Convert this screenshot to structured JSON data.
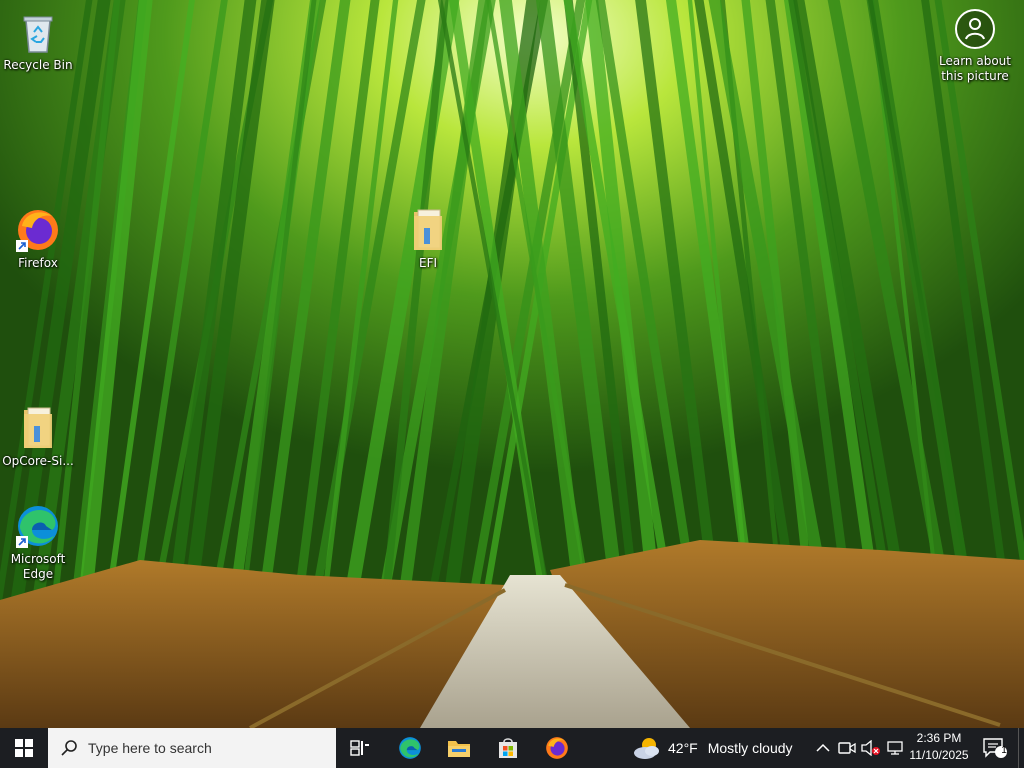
{
  "desktop": {
    "icons": [
      {
        "label": "Recycle Bin",
        "icon": "recycle-bin-icon"
      },
      {
        "label": "Firefox",
        "icon": "firefox-icon"
      },
      {
        "label": "EFI",
        "icon": "folder-icon"
      },
      {
        "label": "OpCore-Si...",
        "icon": "folder-icon"
      },
      {
        "label": "Microsoft Edge",
        "icon": "edge-icon"
      }
    ],
    "learn_picture": {
      "label": "Learn about this picture",
      "icon": "camera-icon"
    }
  },
  "taskbar": {
    "search_placeholder": "Type here to search",
    "apps": [
      "task-view-icon",
      "edge-icon",
      "file-explorer-icon",
      "microsoft-store-icon",
      "firefox-icon"
    ],
    "weather": {
      "temperature": "42°F",
      "condition": "Mostly cloudy",
      "icon": "partly-cloudy-icon"
    },
    "clock": {
      "time": "2:36 PM",
      "date": "11/10/2025"
    },
    "notifications": {
      "count": "1"
    }
  },
  "colors": {
    "taskbar_bg": "#1c1e22",
    "search_bg": "#f3f3f3",
    "windows_blue": "#0078d4"
  }
}
